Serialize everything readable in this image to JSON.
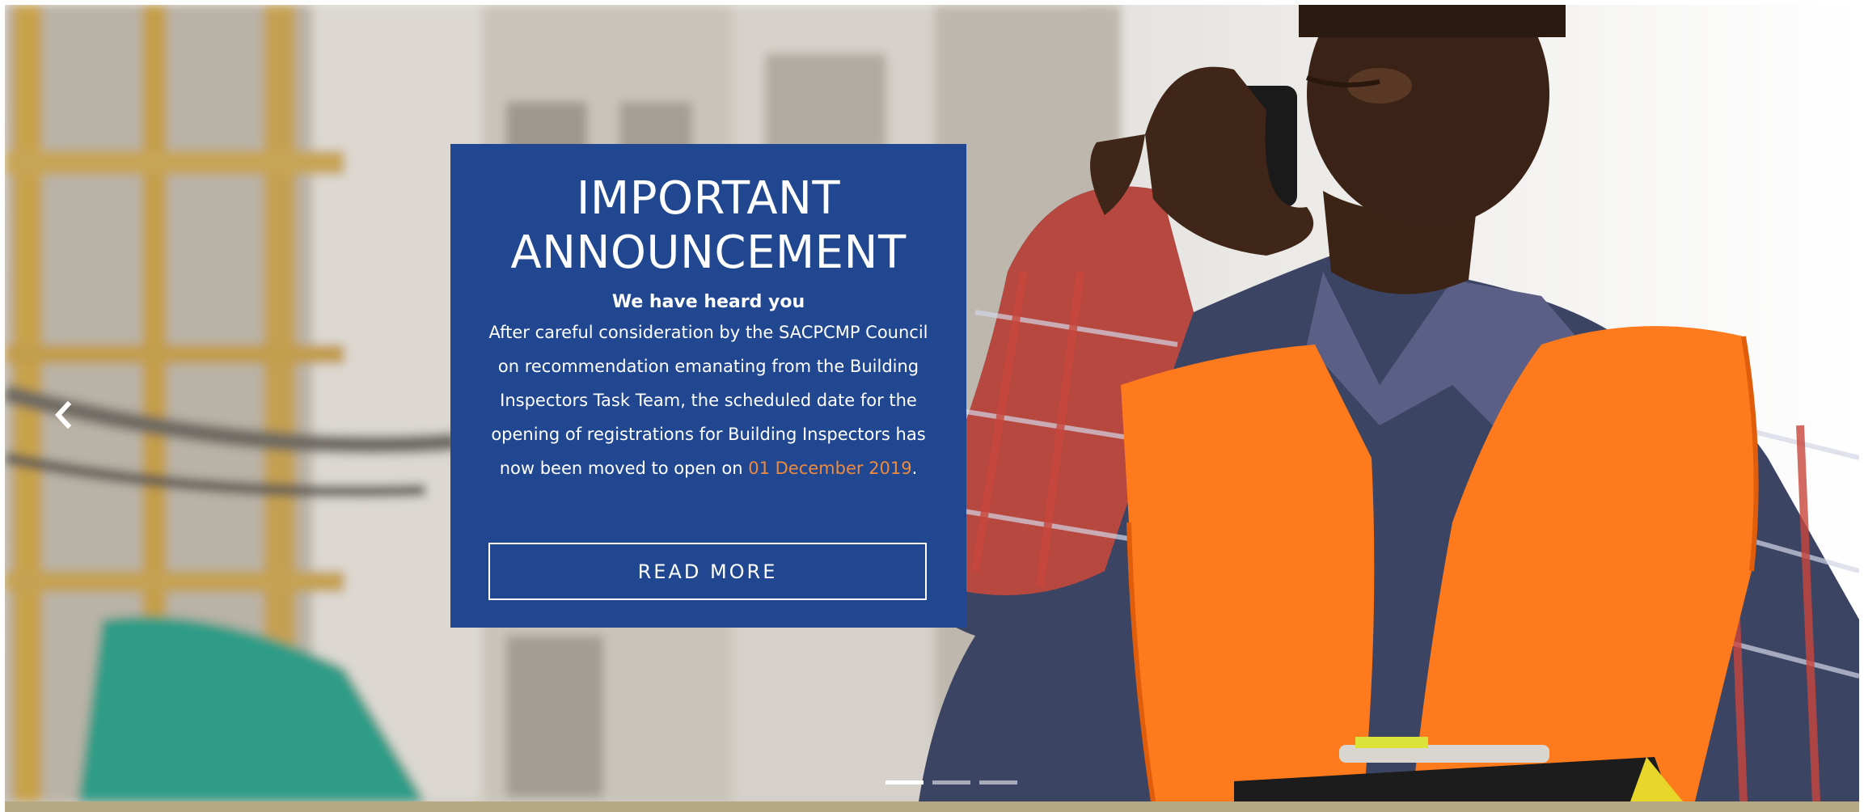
{
  "announcement": {
    "title": "IMPORTANT ANNOUNCEMENT",
    "subtitle": "We have heard you",
    "body_text": "After careful consideration by the SACPCMP Council on recommendation emanating from the Building Inspectors Task Team, the scheduled date for the opening of registrations for Building Inspectors has now been moved to open on",
    "highlight_date": "01 December 2019",
    "body_end": ".",
    "button_label": "READ MORE"
  },
  "carousel": {
    "slide_count": 3,
    "active_slide": 1,
    "prev_icon": "chevron-left-icon",
    "next_icon": "chevron-right-icon"
  },
  "colors": {
    "panel_bg": "#20478f",
    "highlight": "#f08a3c",
    "vest": "#ff7a1c",
    "bottom_bar": "#b6a983"
  }
}
